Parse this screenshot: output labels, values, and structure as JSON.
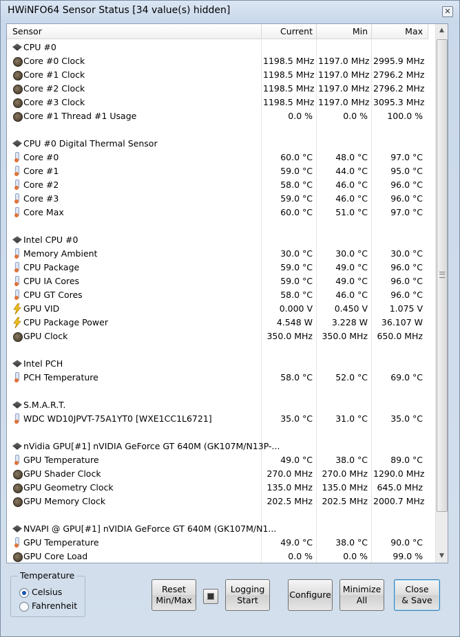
{
  "window": {
    "title": "HWiNFO64 Sensor Status [34 value(s) hidden]"
  },
  "columns": {
    "sensor": "Sensor",
    "current": "Current",
    "min": "Min",
    "max": "Max"
  },
  "rows": [
    {
      "type": "group",
      "icon": "chip-icon",
      "label": "CPU #0"
    },
    {
      "type": "item",
      "icon": "clock-icon",
      "label": "Core #0 Clock",
      "current": "1198.5 MHz",
      "min": "1197.0 MHz",
      "max": "2995.9 MHz"
    },
    {
      "type": "item",
      "icon": "clock-icon",
      "label": "Core #1 Clock",
      "current": "1198.5 MHz",
      "min": "1197.0 MHz",
      "max": "2796.2 MHz"
    },
    {
      "type": "item",
      "icon": "clock-icon",
      "label": "Core #2 Clock",
      "current": "1198.5 MHz",
      "min": "1197.0 MHz",
      "max": "2796.2 MHz"
    },
    {
      "type": "item",
      "icon": "clock-icon",
      "label": "Core #3 Clock",
      "current": "1198.5 MHz",
      "min": "1197.0 MHz",
      "max": "3095.3 MHz"
    },
    {
      "type": "item",
      "icon": "clock-icon",
      "label": "Core #1 Thread #1 Usage",
      "current": "0.0 %",
      "min": "0.0 %",
      "max": "100.0 %"
    },
    {
      "type": "blank"
    },
    {
      "type": "group",
      "icon": "chip-icon",
      "label": "CPU #0 Digital Thermal Sensor"
    },
    {
      "type": "item",
      "icon": "thermometer-icon",
      "label": "Core #0",
      "current": "60.0 °C",
      "min": "48.0 °C",
      "max": "97.0 °C"
    },
    {
      "type": "item",
      "icon": "thermometer-icon",
      "label": "Core #1",
      "current": "59.0 °C",
      "min": "44.0 °C",
      "max": "95.0 °C"
    },
    {
      "type": "item",
      "icon": "thermometer-icon",
      "label": "Core #2",
      "current": "58.0 °C",
      "min": "46.0 °C",
      "max": "96.0 °C"
    },
    {
      "type": "item",
      "icon": "thermometer-icon",
      "label": "Core #3",
      "current": "59.0 °C",
      "min": "46.0 °C",
      "max": "96.0 °C"
    },
    {
      "type": "item",
      "icon": "thermometer-icon",
      "label": "Core Max",
      "current": "60.0 °C",
      "min": "51.0 °C",
      "max": "97.0 °C"
    },
    {
      "type": "blank"
    },
    {
      "type": "group",
      "icon": "chip-icon",
      "label": "Intel CPU #0"
    },
    {
      "type": "item",
      "icon": "thermometer-icon",
      "label": "Memory Ambient",
      "current": "30.0 °C",
      "min": "30.0 °C",
      "max": "30.0 °C"
    },
    {
      "type": "item",
      "icon": "thermometer-icon",
      "label": "CPU Package",
      "current": "59.0 °C",
      "min": "49.0 °C",
      "max": "96.0 °C"
    },
    {
      "type": "item",
      "icon": "thermometer-icon",
      "label": "CPU IA Cores",
      "current": "59.0 °C",
      "min": "49.0 °C",
      "max": "96.0 °C"
    },
    {
      "type": "item",
      "icon": "thermometer-icon",
      "label": "CPU GT Cores",
      "current": "58.0 °C",
      "min": "46.0 °C",
      "max": "96.0 °C"
    },
    {
      "type": "item",
      "icon": "lightning-icon",
      "label": "GPU VID",
      "current": "0.000 V",
      "min": "0.450 V",
      "max": "1.075 V"
    },
    {
      "type": "item",
      "icon": "lightning-icon",
      "label": "CPU Package Power",
      "current": "4.548 W",
      "min": "3.228 W",
      "max": "36.107 W"
    },
    {
      "type": "item",
      "icon": "clock-icon",
      "label": "GPU Clock",
      "current": "350.0 MHz",
      "min": "350.0 MHz",
      "max": "650.0 MHz"
    },
    {
      "type": "blank"
    },
    {
      "type": "group",
      "icon": "chip-icon",
      "label": "Intel PCH"
    },
    {
      "type": "item",
      "icon": "thermometer-icon",
      "label": "PCH Temperature",
      "current": "58.0 °C",
      "min": "52.0 °C",
      "max": "69.0 °C"
    },
    {
      "type": "blank"
    },
    {
      "type": "group",
      "icon": "chip-icon",
      "label": "S.M.A.R.T."
    },
    {
      "type": "item",
      "icon": "thermometer-icon",
      "label": "WDC WD10JPVT-75A1YT0 [WXE1CC1L6721]",
      "current": "35.0 °C",
      "min": "31.0 °C",
      "max": "35.0 °C"
    },
    {
      "type": "blank"
    },
    {
      "type": "group",
      "icon": "chip-icon",
      "label": "nVidia GPU[#1] nVIDIA GeForce GT 640M (GK107M/N13P-..."
    },
    {
      "type": "item",
      "icon": "thermometer-icon",
      "label": "GPU Temperature",
      "current": "49.0 °C",
      "min": "38.0 °C",
      "max": "89.0 °C"
    },
    {
      "type": "item",
      "icon": "clock-icon",
      "label": "GPU Shader Clock",
      "current": "270.0 MHz",
      "min": "270.0 MHz",
      "max": "1290.0 MHz"
    },
    {
      "type": "item",
      "icon": "clock-icon",
      "label": "GPU Geometry Clock",
      "current": "135.0 MHz",
      "min": "135.0 MHz",
      "max": "645.0 MHz"
    },
    {
      "type": "item",
      "icon": "clock-icon",
      "label": "GPU Memory Clock",
      "current": "202.5 MHz",
      "min": "202.5 MHz",
      "max": "2000.7 MHz"
    },
    {
      "type": "blank"
    },
    {
      "type": "group",
      "icon": "chip-icon",
      "label": "NVAPI @ GPU[#1] nVIDIA GeForce GT 640M (GK107M/N1..."
    },
    {
      "type": "item",
      "icon": "thermometer-icon",
      "label": "GPU Temperature",
      "current": "49.0 °C",
      "min": "38.0 °C",
      "max": "90.0 °C"
    },
    {
      "type": "item",
      "icon": "clock-icon",
      "label": "GPU Core Load",
      "current": "0.0 %",
      "min": "0.0 %",
      "max": "99.0 %"
    }
  ],
  "temperature": {
    "legend": "Temperature",
    "celsius": "Celsius",
    "fahrenheit": "Fahrenheit",
    "selected": "Celsius"
  },
  "buttons": {
    "reset_line1": "Reset",
    "reset_line2": "Min/Max",
    "logging_line1": "Logging",
    "logging_line2": "Start",
    "configure": "Configure",
    "minimize_line1": "Minimize",
    "minimize_line2": "All",
    "close_line1": "Close",
    "close_line2": "& Save"
  }
}
